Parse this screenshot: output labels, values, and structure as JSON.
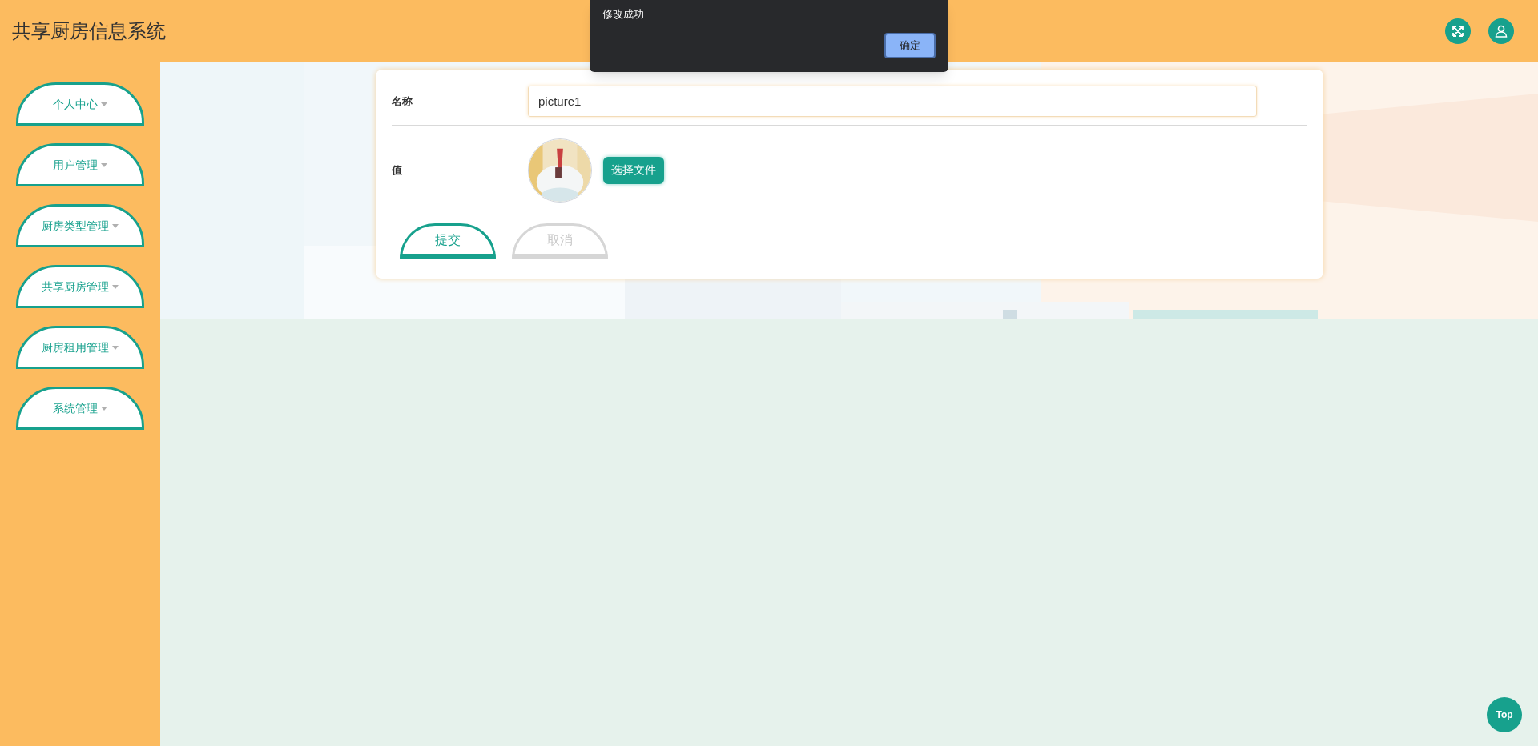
{
  "header": {
    "title": "共享厨房信息系统"
  },
  "sidebar": {
    "items": [
      {
        "label": "个人中心"
      },
      {
        "label": "用户管理"
      },
      {
        "label": "厨房类型管理"
      },
      {
        "label": "共享厨房管理"
      },
      {
        "label": "厨房租用管理"
      },
      {
        "label": "系统管理"
      }
    ]
  },
  "form": {
    "fields": [
      {
        "kind": "text",
        "label": "名称",
        "value": "picture1"
      },
      {
        "label": "值",
        "button": "选择文件"
      }
    ],
    "buttons": [
      {
        "kind": "primary",
        "label": "提交"
      },
      {
        "kind": "secondary",
        "label": "取消"
      }
    ]
  },
  "dialog": {
    "message": "修改成功",
    "button": "确定"
  },
  "back_to_top": "Top"
}
